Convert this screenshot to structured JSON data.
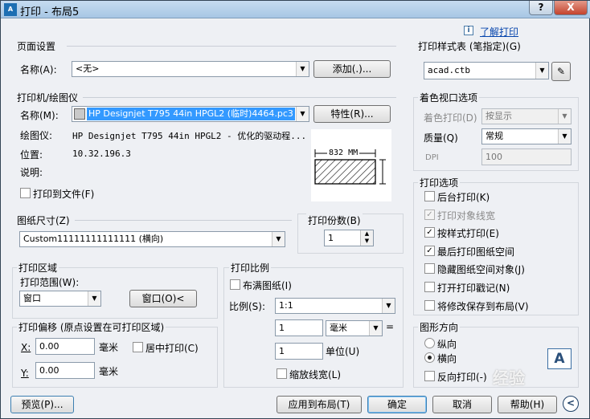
{
  "window": {
    "title": "打印 - 布局5",
    "help": "?",
    "close": "X"
  },
  "help_link": "了解打印",
  "info_icon": "i",
  "page_setup": {
    "title": "页面设置",
    "name_label": "名称(A):",
    "name_value": "<无>",
    "add_button": "添加(.)..."
  },
  "printer": {
    "title": "打印机/绘图仪",
    "name_label": "名称(M):",
    "name_value": "HP Designjet T795 44in HPGL2 (临时)4464.pc3",
    "props_button": "特性(R)...",
    "plotter_label": "绘图仪:",
    "plotter_value": "HP Designjet T795 44in HPGL2 - 优化的驱动程...",
    "location_label": "位置:",
    "location_value": "10.32.196.3",
    "desc_label": "说明:",
    "print_to_file": "打印到文件(F)",
    "paper_width": "832 MM"
  },
  "paper_size": {
    "title": "图纸尺寸(Z)",
    "value": "Custom11111111111111 (横向)"
  },
  "copies": {
    "title": "打印份数(B)",
    "value": "1"
  },
  "print_area": {
    "title": "打印区域",
    "range_label": "打印范围(W):",
    "range_value": "窗口",
    "window_button": "窗口(O)<"
  },
  "offset": {
    "title": "打印偏移 (原点设置在可打印区域)",
    "x_label": "X:",
    "x_value": "0.00",
    "x_unit": "毫米",
    "center_label": "居中打印(C)",
    "y_label": "Y:",
    "y_value": "0.00",
    "y_unit": "毫米"
  },
  "scale": {
    "title": "打印比例",
    "fit_label": "布满图纸(I)",
    "scale_label": "比例(S):",
    "scale_value": "1:1",
    "val1": "1",
    "unit_value": "毫米",
    "eq": "=",
    "val2": "1",
    "unit_label": "单位(U)",
    "lineweight_label": "缩放线宽(L)"
  },
  "style_table": {
    "title": "打印样式表 (笔指定)(G)",
    "value": "acad.ctb"
  },
  "shaded": {
    "title": "着色视口选项",
    "shade_label": "着色打印(D)",
    "shade_value": "按显示",
    "quality_label": "质量(Q)",
    "quality_value": "常规",
    "dpi_label": "DPI",
    "dpi_value": "100"
  },
  "options": {
    "title": "打印选项",
    "items": [
      {
        "label": "后台打印(K)",
        "checked": false,
        "disabled": false
      },
      {
        "label": "打印对象线宽",
        "checked": true,
        "disabled": true
      },
      {
        "label": "按样式打印(E)",
        "checked": true,
        "disabled": false
      },
      {
        "label": "最后打印图纸空间",
        "checked": true,
        "disabled": false
      },
      {
        "label": "隐藏图纸空间对象(J)",
        "checked": false,
        "disabled": false
      },
      {
        "label": "打开打印戳记(N)",
        "checked": false,
        "disabled": false
      },
      {
        "label": "将修改保存到布局(V)",
        "checked": false,
        "disabled": false
      }
    ]
  },
  "orientation": {
    "title": "图形方向",
    "portrait": "纵向",
    "landscape": "横向",
    "reverse": "反向打印(-)",
    "selected": "landscape",
    "page_icon": "A"
  },
  "buttons": {
    "preview": "预览(P)...",
    "apply": "应用到布局(T)",
    "ok": "确定",
    "cancel": "取消",
    "help": "帮助(H)",
    "expand": "<"
  },
  "watermark": "经验"
}
